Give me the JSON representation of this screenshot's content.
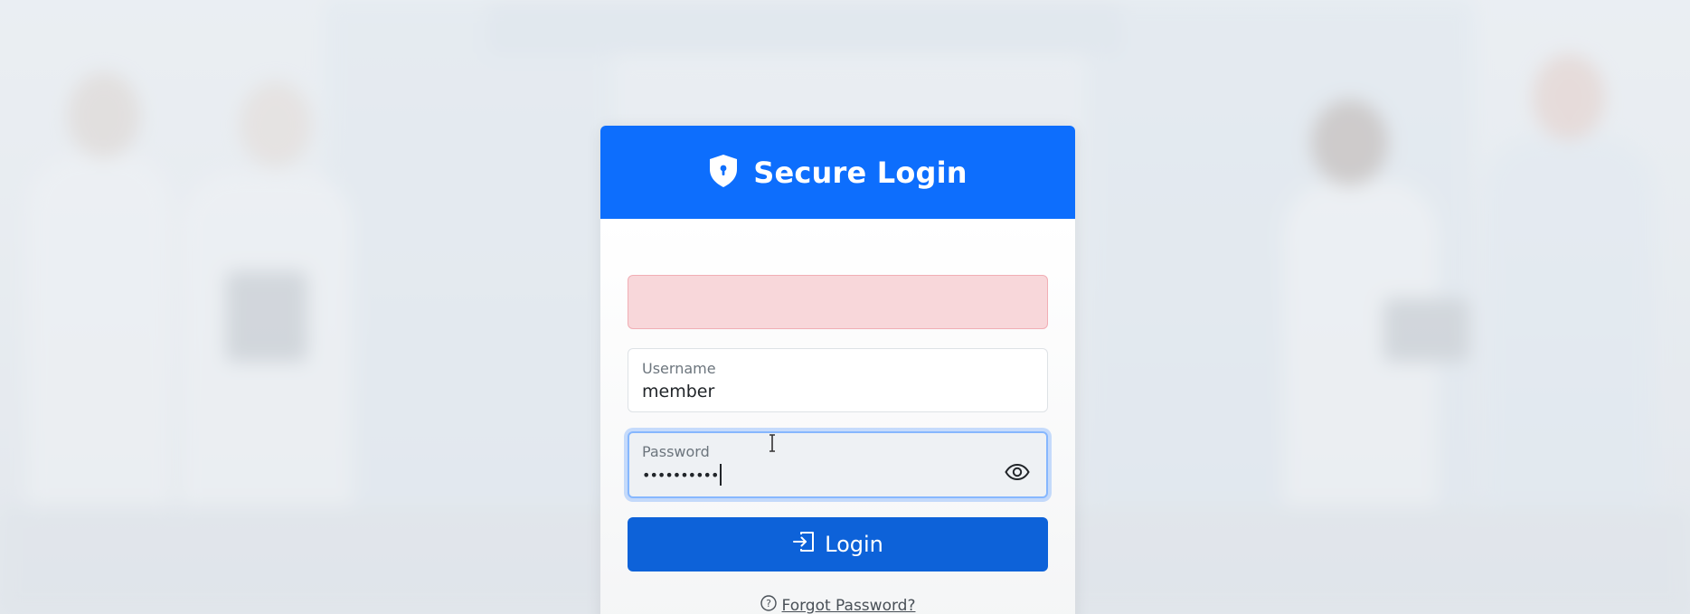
{
  "header": {
    "title": "Secure Login",
    "icon": "shield-lock-icon"
  },
  "alert": {
    "text": "",
    "color": "#f8d7da"
  },
  "username": {
    "label": "Username",
    "value": "member"
  },
  "password": {
    "label": "Password",
    "masked_value": "••••••••••",
    "toggle_icon": "eye-icon"
  },
  "login_button": {
    "label": "Login",
    "icon": "box-arrow-in-right-icon"
  },
  "forgot": {
    "label": "Forgot Password?",
    "icon": "question-circle-icon"
  },
  "colors": {
    "primary": "#0d6efd",
    "button": "#0d62d9",
    "alert_bg": "#f8d7da"
  }
}
